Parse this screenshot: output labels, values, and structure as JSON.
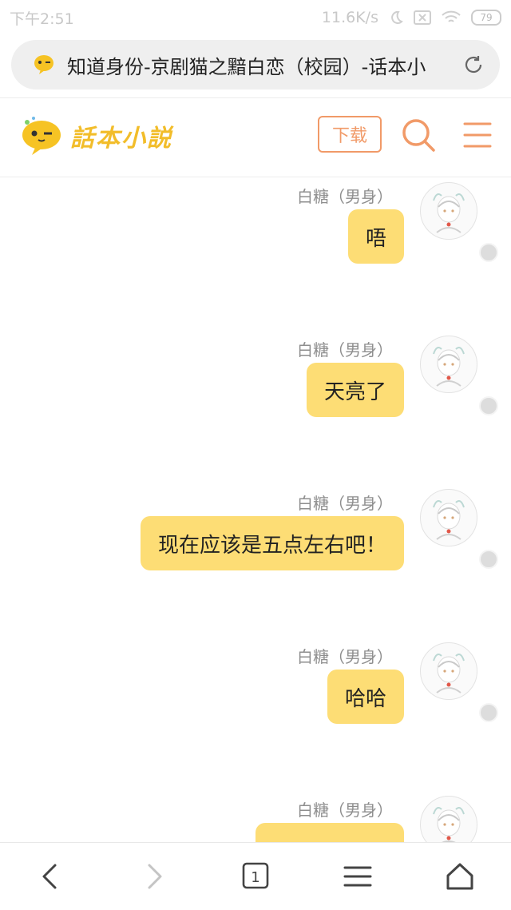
{
  "status": {
    "time": "下午2:51",
    "network_speed": "11.6K/s",
    "battery": "79",
    "icons": [
      "moon-icon",
      "sim-card-icon",
      "wifi-icon",
      "battery-icon"
    ]
  },
  "browser": {
    "page_title": "知道身份-京剧猫之黯白恋（校园）-话本小",
    "icons": [
      "site-favicon-icon",
      "refresh-icon"
    ]
  },
  "header": {
    "logo_text": "話本小説",
    "download_label": "下载",
    "icons": [
      "logo-mascot-icon",
      "search-icon",
      "menu-icon"
    ]
  },
  "messages": [
    {
      "sender": "白糖（男身）",
      "text": "唔"
    },
    {
      "sender": "白糖（男身）",
      "text": "天亮了"
    },
    {
      "sender": "白糖（男身）",
      "text": "现在应该是五点左右吧！"
    },
    {
      "sender": "白糖（男身）",
      "text": "哈哈"
    },
    {
      "sender": "白糖（男身）",
      "text": "…"
    }
  ],
  "bottom_nav": {
    "icons": [
      "back-icon",
      "forward-icon",
      "tabs-icon",
      "menu-icon",
      "home-icon"
    ],
    "tab_count": "1"
  },
  "colors": {
    "bubble": "#fddd75",
    "accent": "#f19a68",
    "logo": "#f2bd2a"
  }
}
